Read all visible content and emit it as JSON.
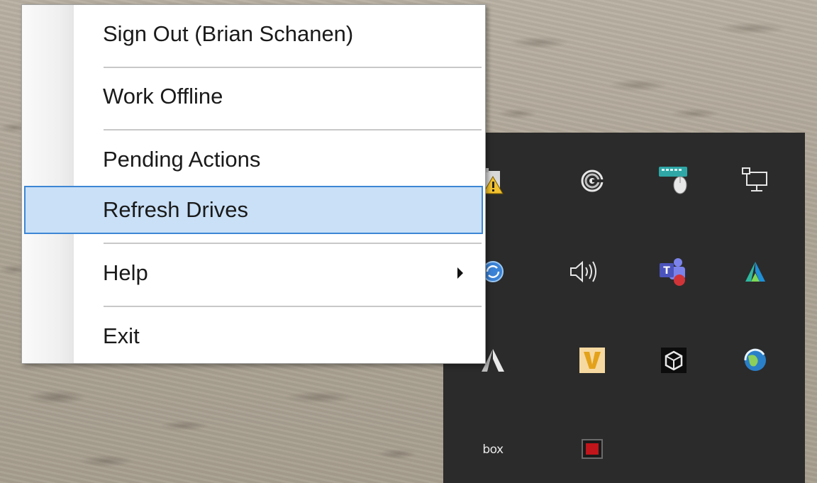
{
  "menu": {
    "items": [
      {
        "label": "Sign Out (Brian Schanen)"
      },
      {
        "label": "Work Offline"
      },
      {
        "label": "Pending Actions"
      },
      {
        "label": "Refresh Drives",
        "highlighted": true
      },
      {
        "label": "Help",
        "has_submenu": true
      },
      {
        "label": "Exit"
      }
    ]
  },
  "tray": {
    "icons": [
      "folder-warning-icon",
      "target-swirl-icon",
      "keyboard-mouse-icon",
      "network-icon",
      "sync-globe-icon",
      "speaker-volume-icon",
      "teams-icon",
      "autodesk-icon",
      "a-app-icon",
      "v-app-icon",
      "cube-app-icon",
      "globe-app-icon",
      "box-icon",
      "red-screen-icon"
    ],
    "box_label": "box"
  },
  "colors": {
    "highlight_fill": "#c9e0f7",
    "highlight_border": "#3d86d4",
    "tray_background": "#2b2b2b"
  }
}
